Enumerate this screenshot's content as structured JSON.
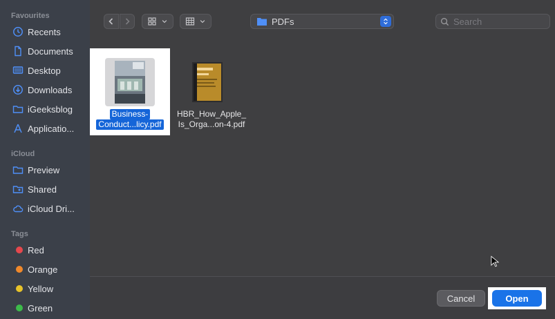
{
  "sidebar": {
    "favourites_header": "Favourites",
    "favourites": [
      {
        "label": "Recents",
        "icon": "clock-icon"
      },
      {
        "label": "Documents",
        "icon": "document-icon"
      },
      {
        "label": "Desktop",
        "icon": "desktop-icon"
      },
      {
        "label": "Downloads",
        "icon": "download-icon"
      },
      {
        "label": "iGeeksblog",
        "icon": "folder-icon"
      },
      {
        "label": "Applicatio...",
        "icon": "applications-icon"
      }
    ],
    "icloud_header": "iCloud",
    "icloud": [
      {
        "label": "Preview",
        "icon": "folder-icon"
      },
      {
        "label": "Shared",
        "icon": "shared-folder-icon"
      },
      {
        "label": "iCloud Dri...",
        "icon": "cloud-icon"
      }
    ],
    "tags_header": "Tags",
    "tags": [
      {
        "label": "Red",
        "color": "#e5484d"
      },
      {
        "label": "Orange",
        "color": "#f0892b"
      },
      {
        "label": "Yellow",
        "color": "#e8c32a"
      },
      {
        "label": "Green",
        "color": "#3dbb4a"
      }
    ]
  },
  "toolbar": {
    "location": "PDFs",
    "search_placeholder": "Search"
  },
  "files": [
    {
      "name_line1": "Business-",
      "name_line2": "Conduct...licy.pdf",
      "selected": true
    },
    {
      "name_line1": "HBR_How_Apple_",
      "name_line2": "Is_Orga...on-4.pdf",
      "selected": false
    }
  ],
  "buttons": {
    "cancel": "Cancel",
    "open": "Open"
  },
  "colors": {
    "accent": "#1a73e8",
    "selection": "#1565d8"
  }
}
